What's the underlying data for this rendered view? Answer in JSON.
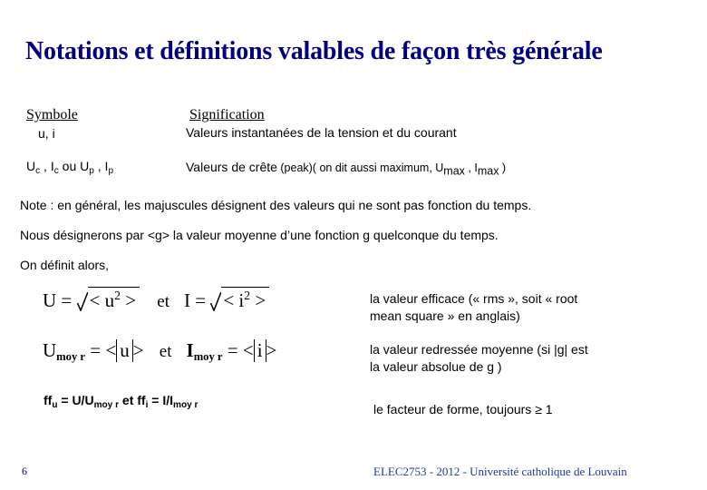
{
  "slide": {
    "title": "Notations et définitions valables de façon très générale",
    "title_color": "#000080"
  },
  "table": {
    "header_symbol": "Symbole",
    "header_meaning": "Signification",
    "rows": [
      {
        "symbol_plain": "u, i",
        "meaning": "Valeurs instantanées de la tension et du courant"
      },
      {
        "symbol_parts": {
          "u_c": "U",
          "u_c_sub": "c",
          "sep1": " , ",
          "i_c": "I",
          "i_c_sub": "c",
          "ou": " ou ",
          "u_p": "U",
          "u_p_sub": "p",
          "sep2": " , ",
          "i_p": "I",
          "i_p_sub": "p"
        },
        "meaning_parts": {
          "lead": "Valeurs de crête",
          "paren": " (peak)( on dit aussi maximum, ",
          "umax": "U",
          "umax_sub": "max",
          "sep": " , ",
          "imax": "I",
          "imax_sub": "max",
          "close": " )"
        }
      }
    ]
  },
  "notes": [
    "Note : en général, les majuscules désignent des valeurs qui ne sont pas fonction du temps.",
    "Nous désignerons par <g> la valeur moyenne d’une fonction g quelconque du temps.",
    "On définit alors,"
  ],
  "formulas": {
    "rms": {
      "lhs_u": "U",
      "eq": " = ",
      "radicand_u": "< u",
      "exp_u": "2",
      "gt_u": " >",
      "et": "et",
      "lhs_i": "I",
      "radicand_i": "< i",
      "exp_i": "2",
      "gt_i": " >"
    },
    "moy": {
      "lhs_u": "U",
      "lhs_u_sub": "moy r",
      "eq_u": " = <",
      "abs_u": "u",
      "gt_u": "> ",
      "et": "et",
      "lhs_i": "I",
      "lhs_i_sub": "moy r",
      "eq_i": " = <",
      "abs_i": "i",
      "gt_i": ">"
    },
    "form_factor": {
      "ff_u": "ff",
      "ff_u_sub": "u",
      "ff_u_eq": " = U/U",
      "ff_u_den_sub": "moy r",
      "et": "  et  ",
      "ff_i": "ff",
      "ff_i_sub": "i",
      "ff_i_eq": " = I/I",
      "ff_i_den_sub": "moy r"
    }
  },
  "annotations": [
    {
      "line1": "la valeur efficace (« rms », soit « root",
      "line2": "mean square » en anglais)"
    },
    {
      "line1": "la valeur redressée moyenne (si |g| est",
      "line2": "la valeur absolue de g  )"
    },
    {
      "line1": "le facteur de forme, toujours ≥ 1",
      "line2": ""
    }
  ],
  "footer": {
    "page_number": "6",
    "credit": "ELEC2753 - 2012 - Université catholique de Louvain",
    "credit_color": "#1F3A93"
  }
}
